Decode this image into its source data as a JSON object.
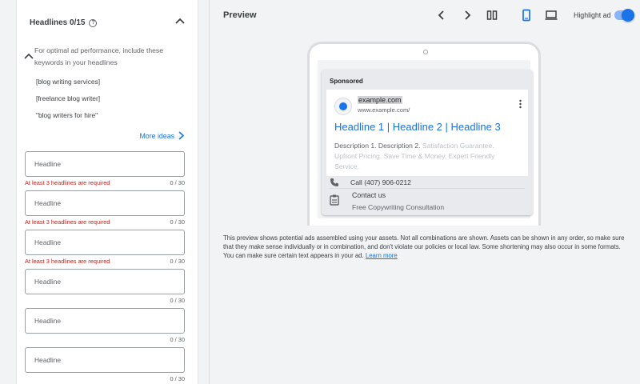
{
  "left": {
    "headlines_title": "Headlines 0/15",
    "tip": "For optimal ad performance, include these keywords in your headlines",
    "keywords": [
      "[blog writing services]",
      "[freelance blog writer]",
      "\"blog writers for hire\""
    ],
    "more_ideas": "More ideas",
    "fields": [
      {
        "placeholder": "Headline",
        "error": "At least 3 headlines are required",
        "count": "0 / 30"
      },
      {
        "placeholder": "Headline",
        "error": "At least 3 headlines are required",
        "count": "0 / 30"
      },
      {
        "placeholder": "Headline",
        "error": "At least 3 headlines are required",
        "count": "0 / 30"
      },
      {
        "placeholder": "Headline",
        "error": "",
        "count": "0 / 30"
      },
      {
        "placeholder": "Headline",
        "error": "",
        "count": "0 / 30"
      },
      {
        "placeholder": "Headline",
        "error": "",
        "count": "0 / 30"
      }
    ]
  },
  "preview": {
    "title": "Preview",
    "highlight_label": "Highlight ad",
    "highlight_on": true,
    "icons": [
      "chevron-left-icon",
      "chevron-right-icon",
      "columns-icon",
      "mobile-icon",
      "desktop-icon"
    ],
    "accent_color": "#1a73e8"
  },
  "ad": {
    "sponsored": "Sponsored",
    "site_name": "example.com",
    "site_url": "www.example.com/",
    "headline": "Headline 1 | Headline 2 | Headline 3",
    "description_main": "Description 1. Description 2.",
    "description_faded": "Satisfaction Guarantee. Upfront Pricing. Save Time & Money. Expert Friendly Service.",
    "call": "Call (407) 906-0212",
    "contact_title": "Contact us",
    "contact_sub": "Free Copywriting Consultation"
  },
  "disclaimer": {
    "text": "This preview shows potential ads assembled using your assets. Not all combinations are shown. Assets can be shown in any order, so make sure that they make sense individually or in combination, and don't violate our policies or local law. Some shortening may also occur in some formats. You can make sure certain text appears in your ad.",
    "link": "Learn more"
  }
}
